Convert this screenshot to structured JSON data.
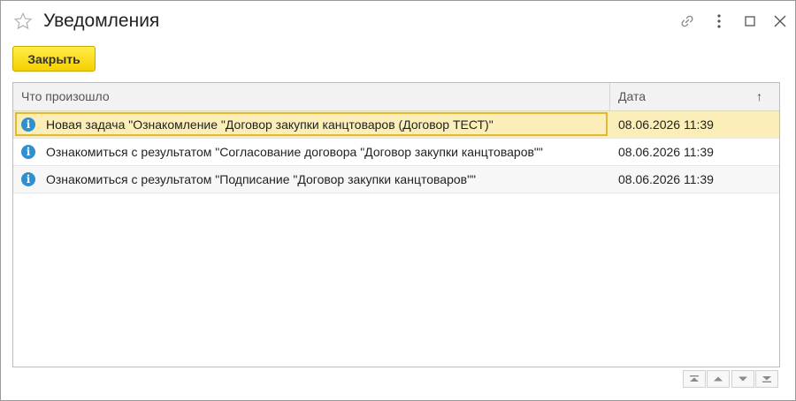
{
  "window": {
    "title": "Уведомления"
  },
  "toolbar": {
    "close_label": "Закрыть"
  },
  "table": {
    "columns": [
      {
        "label": "Что произошло"
      },
      {
        "label": "Дата",
        "sort_indicator": "↑"
      }
    ],
    "rows": [
      {
        "what": "Новая задача \"Ознакомление \"Договор закупки канцтоваров (Договор ТЕСТ)\"",
        "date": "08.06.2026 11:39",
        "icon": "info-icon",
        "selected": true
      },
      {
        "what": "Ознакомиться с результатом \"Согласование договора \"Договор закупки канцтоваров\"\"",
        "date": "08.06.2026 11:39",
        "icon": "info-icon"
      },
      {
        "what": "Ознакомиться с результатом \"Подписание \"Договор закупки канцтоваров\"\"",
        "date": "08.06.2026 11:39",
        "icon": "info-icon"
      }
    ]
  },
  "colors": {
    "accent_button": "#f5d000",
    "selected_row": "#fbeeb9",
    "info_icon": "#2f8fd0"
  }
}
